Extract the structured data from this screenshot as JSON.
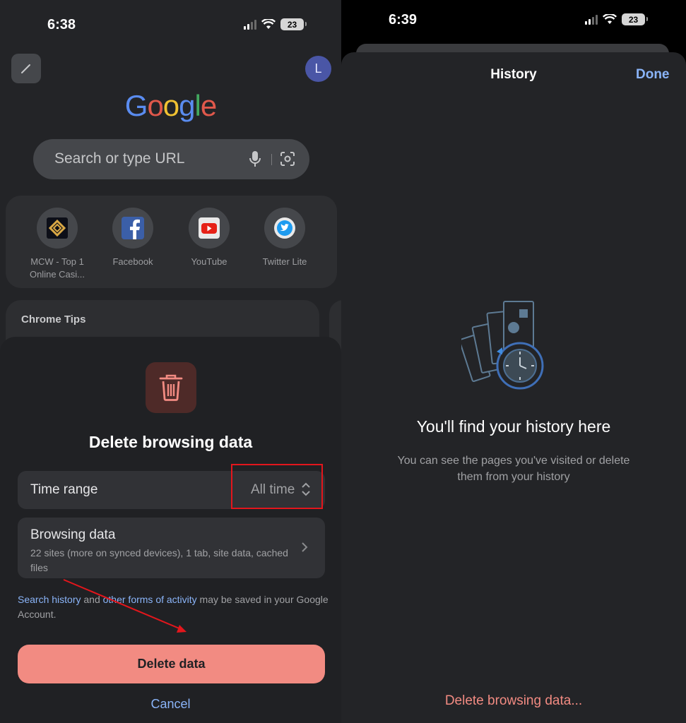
{
  "left": {
    "status": {
      "time": "6:38",
      "battery": "23"
    },
    "avatar_letter": "L",
    "google_letters": [
      "G",
      "o",
      "o",
      "g",
      "l",
      "e"
    ],
    "search": {
      "placeholder": "Search or type URL"
    },
    "shortcuts": [
      {
        "label_1": "MCW - Top 1",
        "label_2": "Online Casi...",
        "icon": "mcw-icon"
      },
      {
        "label_1": "Facebook",
        "label_2": "",
        "icon": "facebook-icon"
      },
      {
        "label_1": "YouTube",
        "label_2": "",
        "icon": "youtube-icon"
      },
      {
        "label_1": "Twitter Lite",
        "label_2": "",
        "icon": "twitter-icon"
      }
    ],
    "tips_title": "Chrome Tips",
    "sheet": {
      "title": "Delete browsing data",
      "time_range_label": "Time range",
      "time_range_value": "All time",
      "browsing_data_label": "Browsing data",
      "browsing_data_desc": "22 sites (more on synced devices), 1 tab, site data, cached files",
      "note_link1": "Search history",
      "note_and": " and ",
      "note_link2": "other forms of activity",
      "note_rest": " may be saved in your Google Account.",
      "delete_button": "Delete data",
      "cancel_button": "Cancel"
    },
    "annotation_color": "#e3161c"
  },
  "right": {
    "status": {
      "time": "6:39",
      "battery": "23"
    },
    "title": "History",
    "done": "Done",
    "empty_title": "You'll find your history here",
    "empty_sub": "You can see the pages you've visited or delete them from your history",
    "delete_link": "Delete browsing data..."
  },
  "colors": {
    "accent_blue": "#8ab4f8",
    "destructive": "#f28b82",
    "sheet_bg": "#202124"
  }
}
